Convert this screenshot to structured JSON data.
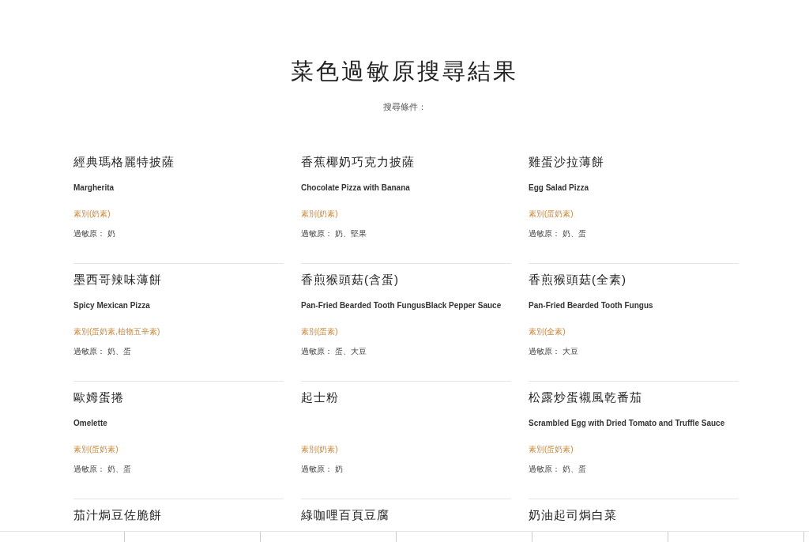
{
  "page_title": "菜色過敏原搜尋結果",
  "search_criteria": "搜尋條件：",
  "dishes": [
    {
      "name": "經典瑪格麗特披薩",
      "english": "Margherita",
      "category": "素別(奶素)",
      "allergens": "過敏原： 奶"
    },
    {
      "name": "香蕉椰奶巧克力披薩",
      "english": "Chocolate Pizza with Banana",
      "category": "素別(奶素)",
      "allergens": "過敏原： 奶、堅果"
    },
    {
      "name": "雞蛋沙拉薄餅",
      "english": "Egg Salad Pizza",
      "category": "素別(蛋奶素)",
      "allergens": "過敏原： 奶、蛋"
    },
    {
      "name": "墨西哥辣味薄餅",
      "english": "Spicy Mexican Pizza",
      "category": "素別(蛋奶素,植物五辛素)",
      "allergens": "過敏原： 奶、蛋"
    },
    {
      "name": "香煎猴頭菇(含蛋)",
      "english": "Pan-Fried Bearded Tooth FungusBlack Pepper Sauce",
      "category": "素別(蛋素)",
      "allergens": "過敏原： 蛋、大豆"
    },
    {
      "name": "香煎猴頭菇(全素)",
      "english": "Pan-Fried Bearded Tooth Fungus",
      "category": "素別(全素)",
      "allergens": "過敏原： 大豆"
    },
    {
      "name": "歐姆蛋捲",
      "english": "Omelette",
      "category": "素別(蛋奶素)",
      "allergens": "過敏原： 奶、蛋"
    },
    {
      "name": "起士粉",
      "category": "素別(奶素)",
      "allergens": "過敏原： 奶"
    },
    {
      "name": "松露炒蛋襯風乾番茄",
      "english": "Scrambled Egg with Dried Tomato and Truffle Sauce",
      "category": "素別(蛋奶素)",
      "allergens": "過敏原： 奶、蛋"
    },
    {
      "name": "茄汁焗豆佐脆餅"
    },
    {
      "name": "綠咖哩百頁豆腐"
    },
    {
      "name": "奶油起司焗白菜"
    }
  ]
}
